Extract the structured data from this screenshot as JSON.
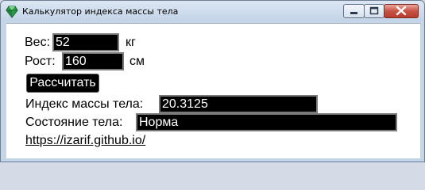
{
  "window": {
    "title": "Калькулятор индекса массы тела"
  },
  "form": {
    "weight_label": "Вес:",
    "weight_value": "52",
    "weight_unit": "кг",
    "height_label": "Рост:",
    "height_value": "160",
    "height_unit": "см",
    "calculate_label": "Рассчитать",
    "bmi_label": "Индекс массы тела:",
    "bmi_value": "20.3125",
    "status_label": "Состояние тела:",
    "status_value": "Норма",
    "link_text": "https://izarif.github.io/"
  },
  "colors": {
    "field_bg": "#000000",
    "field_text": "#ffffff",
    "window_frame": "#c5d5e8",
    "close_button": "#c75344"
  },
  "icons": {
    "app": "green-gem-icon",
    "minimize": "minimize-icon",
    "maximize": "maximize-icon",
    "close": "close-icon"
  }
}
